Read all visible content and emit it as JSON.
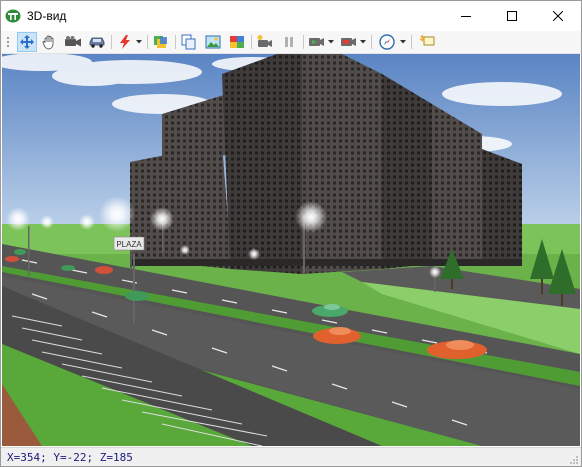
{
  "window": {
    "title": "3D-вид"
  },
  "toolbar": {
    "buttons": [
      {
        "id": "move",
        "icon": "move-arrows-icon",
        "active": true
      },
      {
        "id": "pan",
        "icon": "hand-icon"
      },
      {
        "id": "camera",
        "icon": "video-camera-icon"
      },
      {
        "id": "car",
        "icon": "car-icon"
      },
      {
        "id": "lightning",
        "icon": "lightning-icon",
        "dropdown": true
      },
      {
        "id": "layers",
        "icon": "layers-icon"
      },
      {
        "id": "copy",
        "icon": "copy-icon"
      },
      {
        "id": "image",
        "icon": "picture-icon"
      },
      {
        "id": "texture",
        "icon": "texture-icon"
      },
      {
        "id": "record",
        "icon": "record-camera-icon"
      },
      {
        "id": "pause",
        "icon": "pause-icon"
      },
      {
        "id": "play-camera",
        "icon": "play-camera-icon",
        "dropdown": true
      },
      {
        "id": "save-view",
        "icon": "save-view-icon",
        "dropdown": true
      },
      {
        "id": "compass",
        "icon": "compass-icon",
        "dropdown": true
      },
      {
        "id": "hint",
        "icon": "tooltip-icon"
      }
    ]
  },
  "scene": {
    "sign_text": "PLAZA",
    "colors": {
      "sky_top": "#5a84c4",
      "sky_bottom": "#cfe0f0",
      "grass": "#58a83a",
      "road": "#555555",
      "building": "#3f3b3a"
    }
  },
  "status": {
    "coordinates": "X=354; Y=-22; Z=185"
  }
}
